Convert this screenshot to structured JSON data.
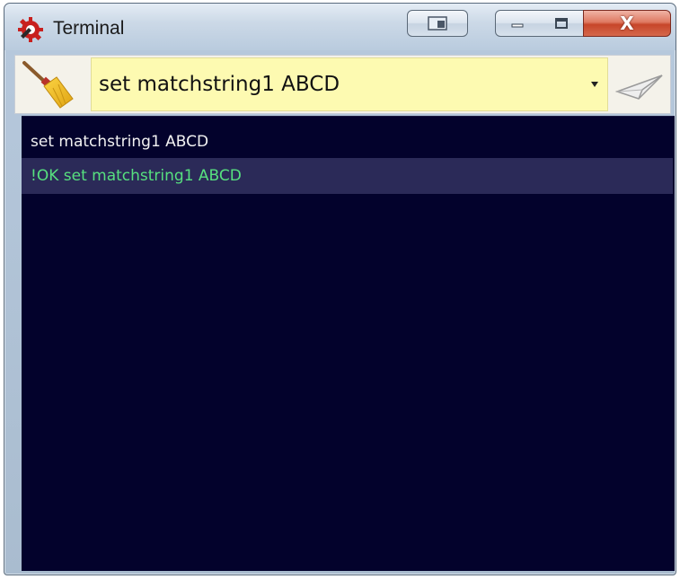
{
  "window": {
    "title": "Terminal",
    "close_label": "X"
  },
  "toolbar": {
    "clear_icon": "broom-icon",
    "command_value": "set matchstring1 ABCD",
    "send_icon": "paper-plane-icon"
  },
  "terminal": {
    "lines": [
      {
        "text": "set matchstring1 ABCD",
        "color": "#f2f2f2"
      },
      {
        "text": "!OK set matchstring1 ABCD",
        "color": "#57e07f"
      }
    ],
    "background": "#03022c",
    "highlight_row": "#2b2a58"
  }
}
